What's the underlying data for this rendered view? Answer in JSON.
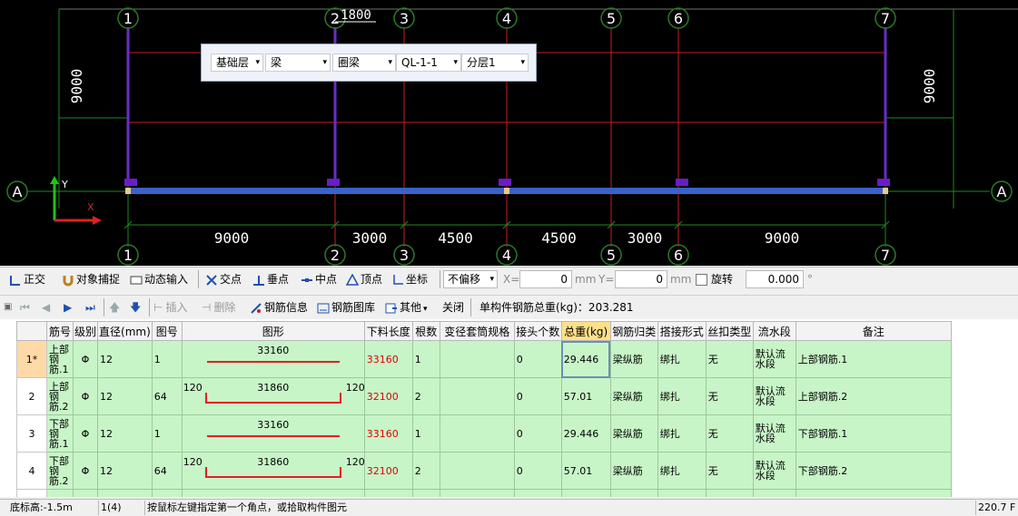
{
  "drawing": {
    "axes_top": [
      "1",
      "2",
      "3",
      "4",
      "5",
      "6",
      "7"
    ],
    "axes_bottom": [
      "1",
      "2",
      "3",
      "4",
      "5",
      "6",
      "7"
    ],
    "axis_row": "A",
    "dims_bottom": [
      "9000",
      "3000",
      "4500",
      "4500",
      "3000",
      "9000"
    ],
    "dim_left": "9000",
    "dim_right": "9000",
    "dim_top_partial": "1800",
    "ucs_y": "Y",
    "ucs_x": "X",
    "colors": {
      "beam": "#3a62c8",
      "grid_red": "#c81e1e",
      "grid_green": "#1e8a1e",
      "axis_text": "#ffffff",
      "bubble": "#2a7a2a",
      "support": "#6b2cc8"
    }
  },
  "layer_bar": {
    "floor": "基础层",
    "category": "梁",
    "type": "圈梁",
    "component": "QL-1-1",
    "sublayer": "分层1"
  },
  "snap_toolbar": {
    "ortho": "正交",
    "object_snap": "对象捕捉",
    "dynamic_input": "动态输入",
    "intersection": "交点",
    "perpendicular": "垂点",
    "midpoint": "中点",
    "vertex": "顶点",
    "coordinate": "坐标",
    "offset_mode": "不偏移",
    "x_label": "X=",
    "x_value": "0",
    "y_label": "Y=",
    "y_value": "0",
    "unit_mm": "mm",
    "rotate_label": "旋转",
    "rotate_value": "0.000",
    "degree": "°"
  },
  "grid_toolbar": {
    "insert": "插入",
    "delete": "删除",
    "rebar_info": "钢筋信息",
    "rebar_library": "钢筋图库",
    "other": "其他",
    "close": "关闭",
    "total_weight": "单构件钢筋总重(kg)：203.281"
  },
  "table": {
    "headers": [
      "筋号",
      "级别",
      "直径(mm)",
      "图号",
      "图形",
      "下料长度",
      "根数",
      "变径套筒规格",
      "接头个数",
      "总重(kg)",
      "钢筋归类",
      "搭接形式",
      "丝扣类型",
      "流水段",
      "备注"
    ],
    "rows": [
      {
        "num": "1*",
        "name": "上部钢筋.1",
        "grade": "Φ",
        "diameter": "12",
        "fig": "1",
        "shape_mid": "33160",
        "shape_left": "",
        "shape_right": "",
        "length": "33160",
        "count": "1",
        "sleeve": "",
        "joints": "0",
        "weight": "29.446",
        "category": "梁纵筋",
        "lap": "绑扎",
        "thread": "无",
        "stage": "默认流水段",
        "note": "上部钢筋.1"
      },
      {
        "num": "2",
        "name": "上部钢筋.2",
        "grade": "Φ",
        "diameter": "12",
        "fig": "64",
        "shape_mid": "31860",
        "shape_left": "120",
        "shape_right": "120",
        "length": "32100",
        "count": "2",
        "sleeve": "",
        "joints": "0",
        "weight": "57.01",
        "category": "梁纵筋",
        "lap": "绑扎",
        "thread": "无",
        "stage": "默认流水段",
        "note": "上部钢筋.2"
      },
      {
        "num": "3",
        "name": "下部钢筋.1",
        "grade": "Φ",
        "diameter": "12",
        "fig": "1",
        "shape_mid": "33160",
        "shape_left": "",
        "shape_right": "",
        "length": "33160",
        "count": "1",
        "sleeve": "",
        "joints": "0",
        "weight": "29.446",
        "category": "梁纵筋",
        "lap": "绑扎",
        "thread": "无",
        "stage": "默认流水段",
        "note": "下部钢筋.1"
      },
      {
        "num": "4",
        "name": "下部钢筋.2",
        "grade": "Φ",
        "diameter": "12",
        "fig": "64",
        "shape_mid": "31860",
        "shape_left": "120",
        "shape_right": "120",
        "length": "32100",
        "count": "2",
        "sleeve": "",
        "joints": "0",
        "weight": "57.01",
        "category": "梁纵筋",
        "lap": "绑扎",
        "thread": "无",
        "stage": "默认流水段",
        "note": "下部钢筋.2"
      }
    ]
  },
  "status_bar": {
    "elevation": "底标高:-1.5m",
    "count": "1(4)",
    "hint": "按鼠标左键指定第一个角点，或拾取构件图元",
    "coord": "220.7 F"
  }
}
